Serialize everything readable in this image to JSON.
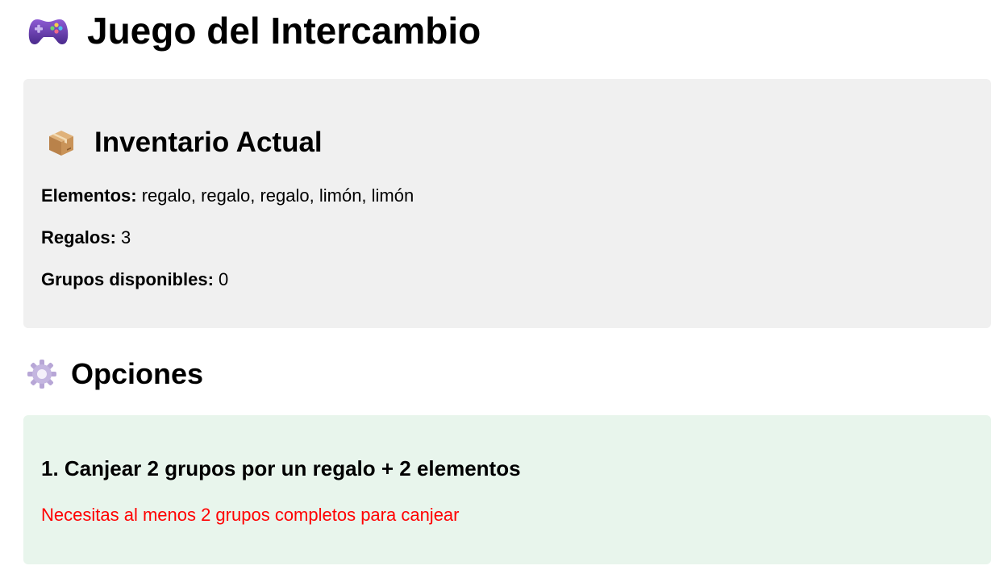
{
  "header": {
    "title": "Juego del Intercambio",
    "icon": "gamepad-icon"
  },
  "inventory": {
    "heading": "Inventario Actual",
    "icon": "package-icon",
    "items_label": "Elementos:",
    "items_value": "regalo, regalo, regalo, limón, limón",
    "gifts_label": "Regalos:",
    "gifts_value": "3",
    "groups_label": "Grupos disponibles:",
    "groups_value": "0"
  },
  "options": {
    "heading": "Opciones",
    "icon": "gear-icon",
    "items": [
      {
        "title": "1. Canjear 2 grupos por un regalo + 2 elementos",
        "warning": "Necesitas al menos 2 grupos completos para canjear"
      }
    ]
  },
  "colors": {
    "inventory_bg": "#f0f0f0",
    "option_bg": "#e8f5ec",
    "warning_text": "#ff0000"
  }
}
